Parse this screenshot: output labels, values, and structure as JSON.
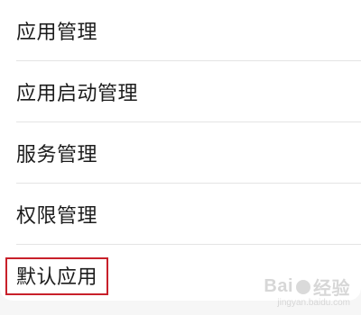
{
  "settings_list": {
    "items": [
      {
        "label": "应用管理"
      },
      {
        "label": "应用启动管理"
      },
      {
        "label": "服务管理"
      },
      {
        "label": "权限管理"
      },
      {
        "label": "默认应用"
      }
    ],
    "highlighted_item_index": 4
  },
  "watermark": {
    "brand_left": "Bai",
    "brand_right": "经验",
    "url": "jingyan.baidu.com"
  },
  "colors": {
    "highlight_border": "#c8202a",
    "text": "#1c1c1c",
    "divider": "#e4e4e4",
    "background": "#f6f6f6"
  }
}
